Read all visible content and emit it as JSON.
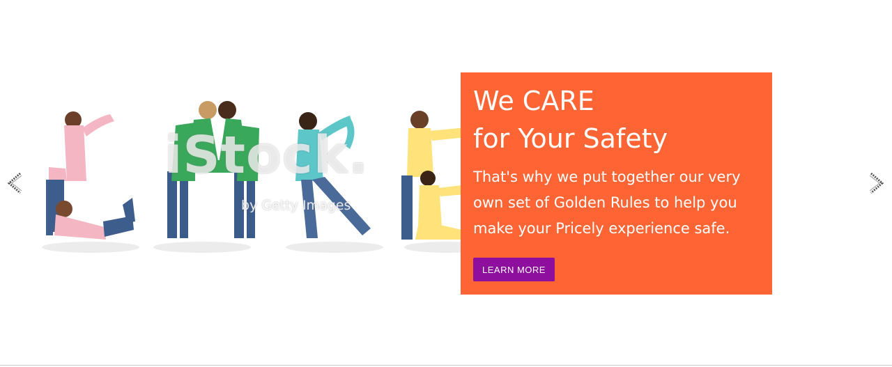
{
  "slide": {
    "photo_name": "children-spelling-care-photo",
    "watermark": "iStock.",
    "watermark_sub": "by Getty Images",
    "title_line1": "We CARE",
    "title_line2": "for Your Safety",
    "body": "That's why we put together our very own set of Golden Rules to help you make your Pricely experience safe.",
    "cta_label": "LEARN MORE"
  },
  "navigation": {
    "prev_icon": "chevron-left-icon",
    "next_icon": "chevron-right-icon"
  },
  "colors": {
    "card_bg": "#ff6534",
    "cta_bg": "#8e0e9e",
    "page_bg": "#ffffff"
  }
}
